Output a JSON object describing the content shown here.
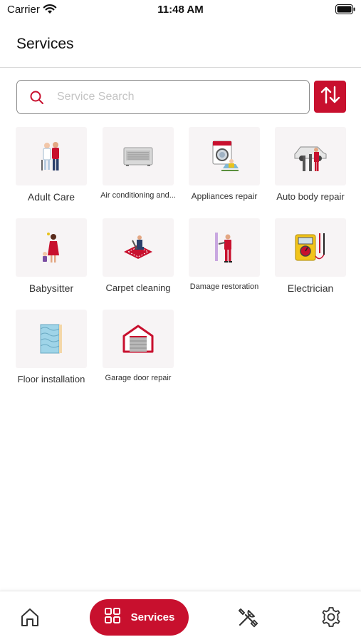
{
  "status_bar": {
    "carrier": "Carrier",
    "time": "11:48 AM"
  },
  "header": {
    "title": "Services"
  },
  "search": {
    "placeholder": "Service Search",
    "value": ""
  },
  "services": [
    {
      "label": "Adult Care",
      "icon": "adult-care-illustration"
    },
    {
      "label": "Air conditioning and...",
      "icon": "air-conditioner-illustration"
    },
    {
      "label": "Appliances repair",
      "icon": "washing-machine-illustration"
    },
    {
      "label": "Auto body repair",
      "icon": "car-repair-illustration"
    },
    {
      "label": "Babysitter",
      "icon": "babysitter-illustration"
    },
    {
      "label": "Carpet cleaning",
      "icon": "carpet-cleaning-illustration"
    },
    {
      "label": "Damage restoration",
      "icon": "damage-restoration-illustration"
    },
    {
      "label": "Electrician",
      "icon": "multimeter-illustration"
    },
    {
      "label": "Floor installation",
      "icon": "floor-tile-illustration"
    },
    {
      "label": "Garage door repair",
      "icon": "garage-illustration"
    }
  ],
  "tab_bar": {
    "items": [
      {
        "icon": "home-icon"
      },
      {
        "label": "Services",
        "icon": "grid-icon",
        "active": true
      },
      {
        "icon": "tools-icon"
      },
      {
        "icon": "gear-icon"
      }
    ]
  },
  "colors": {
    "accent": "#c8102e",
    "tile_bg": "#f7f4f5"
  }
}
